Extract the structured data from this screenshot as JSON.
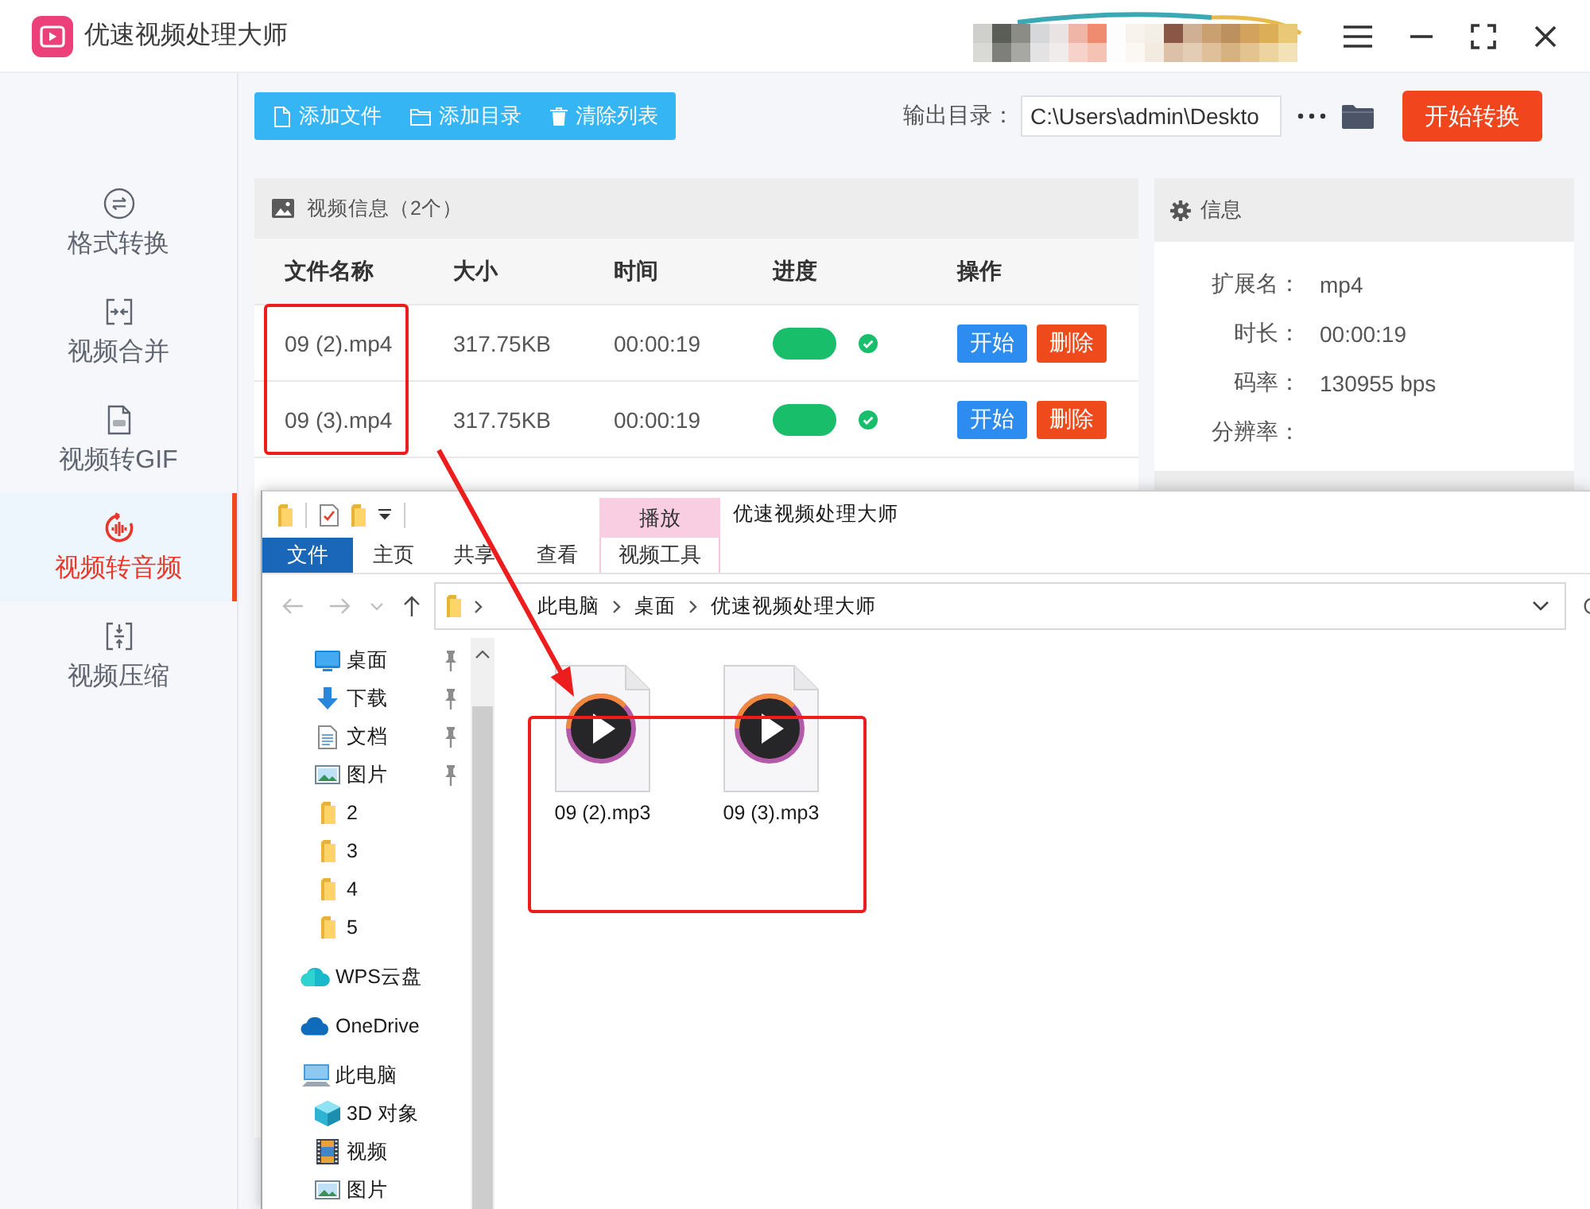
{
  "window": {
    "title": "优速视频处理大师"
  },
  "sidebar": {
    "items": [
      {
        "label": "格式转换",
        "kind": "convert",
        "selected": false
      },
      {
        "label": "视频合并",
        "kind": "merge",
        "selected": false
      },
      {
        "label": "视频转GIF",
        "kind": "gif",
        "selected": false
      },
      {
        "label": "视频转音频",
        "kind": "audio",
        "selected": true
      },
      {
        "label": "视频压缩",
        "kind": "compress",
        "selected": false
      }
    ]
  },
  "toolbar": {
    "buttons": [
      {
        "label": "添加文件",
        "kind": "file"
      },
      {
        "label": "添加目录",
        "kind": "folder"
      },
      {
        "label": "清除列表",
        "kind": "trash"
      }
    ],
    "output_label": "输出目录：",
    "output_path": "C:\\Users\\admin\\Deskto",
    "start_button": "开始转换"
  },
  "file_panel": {
    "title": "视频信息（2个）",
    "columns": [
      "文件名称",
      "大小",
      "时间",
      "进度",
      "操作"
    ],
    "rows": [
      {
        "name": "09 (2).mp4",
        "size": "317.75KB",
        "time": "00:00:19",
        "level": 1,
        "done": true,
        "actions": [
          {
            "label": "开始",
            "kind": "start"
          },
          {
            "label": "删除",
            "kind": "delete"
          }
        ]
      },
      {
        "name": "09 (3).mp4",
        "size": "317.75KB",
        "time": "00:00:19",
        "level": 1,
        "done": true,
        "actions": [
          {
            "label": "开始",
            "kind": "start"
          },
          {
            "label": "删除",
            "kind": "delete"
          }
        ]
      }
    ]
  },
  "info_panel": {
    "title": "信息",
    "fields": [
      {
        "label": "扩展名：",
        "value": "mp4"
      },
      {
        "label": "时长：",
        "value": "00:00:19"
      },
      {
        "label": "码率：",
        "value": "130955 bps"
      },
      {
        "label": "分辨率："
      }
    ]
  },
  "explorer": {
    "context_tab": "播放",
    "title": "优速视频处理大师",
    "ribbon_tabs": [
      {
        "label": "文件",
        "kind": "file"
      },
      {
        "label": "主页",
        "kind": "tab"
      },
      {
        "label": "共享",
        "kind": "tab"
      },
      {
        "label": "查看",
        "kind": "tab"
      },
      {
        "label": "视频工具",
        "kind": "context"
      }
    ],
    "nav_buttons": [
      {
        "kind": "back",
        "disabled": true
      },
      {
        "kind": "forward",
        "disabled": true
      },
      {
        "kind": "recent",
        "disabled": true
      },
      {
        "kind": "up",
        "disabled": false
      }
    ],
    "address": [
      "此电脑",
      "桌面",
      "优速视频处理大师"
    ],
    "quick_access": [
      {
        "label": "桌面",
        "kind": "desktop",
        "pinned": true
      },
      {
        "label": "下载",
        "kind": "downloads",
        "pinned": true
      },
      {
        "label": "文档",
        "kind": "documents",
        "pinned": true
      },
      {
        "label": "图片",
        "kind": "pictures",
        "pinned": true
      },
      {
        "label": "2",
        "kind": "folder",
        "pinned": false
      },
      {
        "label": "3",
        "kind": "folder",
        "pinned": false
      },
      {
        "label": "4",
        "kind": "folder",
        "pinned": false
      },
      {
        "label": "5",
        "kind": "folder",
        "pinned": false
      }
    ],
    "nav_items": [
      {
        "label": "WPS云盘",
        "kind": "wps"
      },
      {
        "label": "OneDrive",
        "kind": "onedrive"
      },
      {
        "label": "此电脑",
        "kind": "computer",
        "children": [
          {
            "label": "3D 对象",
            "kind": "objects"
          },
          {
            "label": "视频",
            "kind": "videos"
          },
          {
            "label": "图片",
            "kind": "pictures"
          }
        ]
      }
    ],
    "files": [
      "09 (2).mp3",
      "09 (3).mp3"
    ]
  }
}
